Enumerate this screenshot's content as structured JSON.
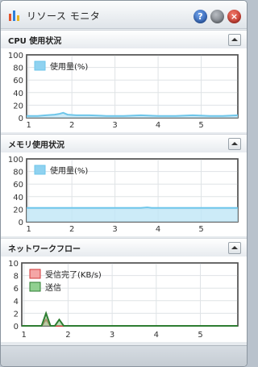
{
  "window": {
    "title": "リソース モニタ",
    "buttons": {
      "help": "?",
      "minimize": "",
      "close": "×"
    }
  },
  "panels": {
    "cpu": {
      "title": "CPU 使用状況"
    },
    "memory": {
      "title": "メモリ使用状況"
    },
    "network": {
      "title": "ネットワークフロー"
    }
  },
  "chart_data": [
    {
      "type": "line",
      "title": "CPU 使用状況",
      "yticks": [
        "0",
        "20",
        "40",
        "60",
        "80",
        "100"
      ],
      "xticks": [
        "1",
        "2",
        "3",
        "4",
        "5"
      ],
      "ylim": [
        0,
        100
      ],
      "xlim": [
        0.95,
        5.85
      ],
      "series": [
        {
          "name": "使用量(%)",
          "color": "#6ec6ea",
          "x": [
            0.95,
            1.2,
            1.4,
            1.6,
            1.7,
            1.8,
            1.9,
            2.1,
            2.4,
            2.8,
            3.2,
            3.6,
            4.0,
            4.4,
            4.8,
            5.2,
            5.5,
            5.85
          ],
          "y": [
            3,
            3,
            4,
            5,
            6,
            8,
            5,
            4,
            4,
            3,
            3,
            4,
            3,
            3,
            4,
            3,
            3,
            4
          ]
        }
      ],
      "legend": "top-left"
    },
    {
      "type": "line",
      "title": "メモリ使用状況",
      "yticks": [
        "0",
        "20",
        "40",
        "60",
        "80",
        "100"
      ],
      "xticks": [
        "1",
        "2",
        "3",
        "4",
        "5"
      ],
      "ylim": [
        0,
        100
      ],
      "xlim": [
        0.95,
        5.85
      ],
      "series": [
        {
          "name": "使用量(%)",
          "color": "#6ec6ea",
          "x": [
            0.95,
            2.0,
            3.0,
            3.6,
            3.75,
            3.85,
            4.5,
            5.85
          ],
          "y": [
            22,
            22,
            22,
            22,
            23,
            22,
            22,
            22
          ]
        }
      ],
      "legend": "top-left"
    },
    {
      "type": "line",
      "title": "ネットワークフロー",
      "yticks": [
        "0",
        "2",
        "4",
        "6",
        "8",
        "10"
      ],
      "xticks": [
        "1",
        "2",
        "3",
        "4",
        "5"
      ],
      "ylim": [
        0,
        10
      ],
      "xlim": [
        0.95,
        5.85
      ],
      "series": [
        {
          "name": "受信完了(KB/s)",
          "color": "#d23b3b",
          "fill": "#f4a6a6",
          "x": [
            0.95,
            1.4,
            1.5,
            1.6,
            1.7,
            1.8,
            1.9,
            5.85
          ],
          "y": [
            0,
            0,
            1,
            0,
            0,
            0,
            0,
            0
          ]
        },
        {
          "name": "送信",
          "color": "#2e7d32",
          "fill": "#90d090",
          "x": [
            0.95,
            1.4,
            1.5,
            1.6,
            1.7,
            1.8,
            1.9,
            5.85
          ],
          "y": [
            0,
            0,
            2,
            0,
            0,
            1,
            0,
            0
          ]
        }
      ],
      "legend": "top-left"
    }
  ]
}
